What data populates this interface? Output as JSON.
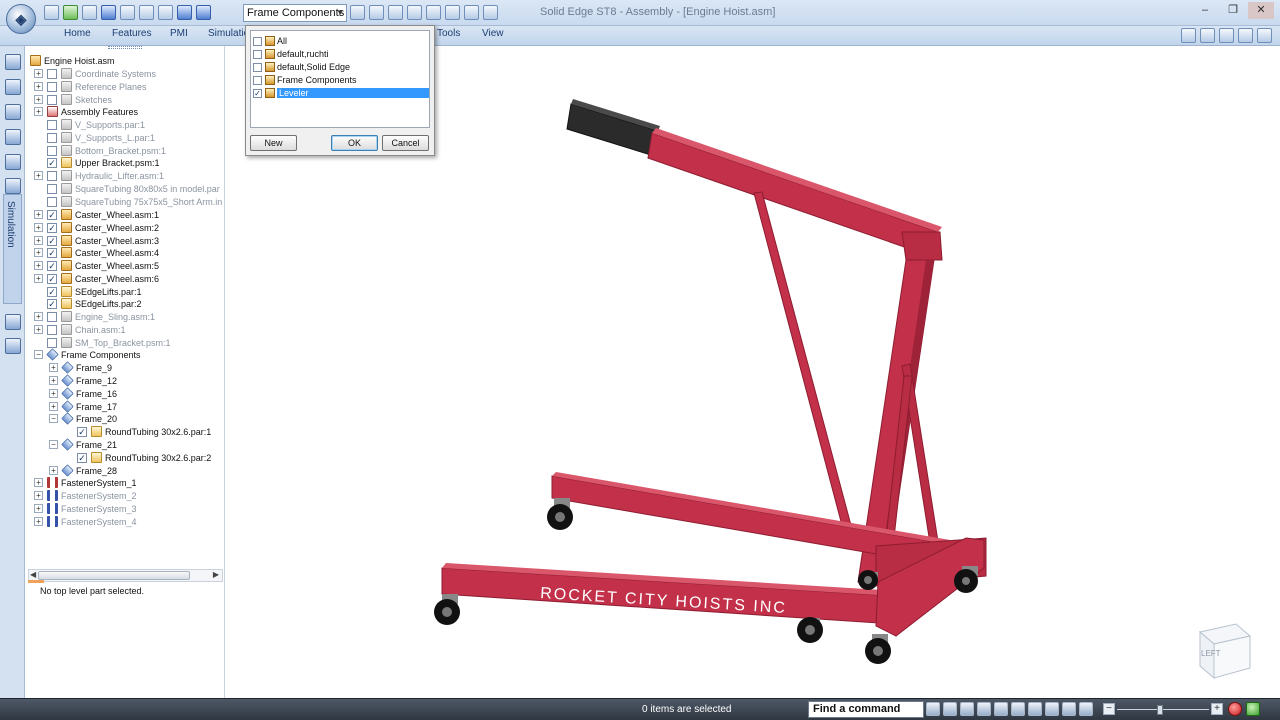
{
  "window": {
    "title": "Solid Edge ST8 - Assembly - [Engine Hoist.asm]"
  },
  "quick_access": {
    "combo_value": "Frame Components"
  },
  "ribbon": {
    "tabs": [
      "Home",
      "Features",
      "PMI",
      "Simulatio",
      "Tools",
      "View"
    ]
  },
  "dock": {
    "simulation_tab": "Simulation"
  },
  "tree": {
    "items": [
      {
        "label": "Engine Hoist.asm"
      },
      {
        "label": "Coordinate Systems"
      },
      {
        "label": "Reference Planes"
      },
      {
        "label": "Sketches"
      },
      {
        "label": "Assembly Features"
      },
      {
        "label": "V_Supports.par:1"
      },
      {
        "label": "V_Supports_L.par:1"
      },
      {
        "label": "Bottom_Bracket.psm:1"
      },
      {
        "label": "Upper Bracket.psm:1"
      },
      {
        "label": "Hydraulic_Lifter.asm:1"
      },
      {
        "label": "SquareTubing 80x80x5 in model.par"
      },
      {
        "label": "SquareTubing 75x75x5_Short Arm.in"
      },
      {
        "label": "Caster_Wheel.asm:1"
      },
      {
        "label": "Caster_Wheel.asm:2"
      },
      {
        "label": "Caster_Wheel.asm:3"
      },
      {
        "label": "Caster_Wheel.asm:4"
      },
      {
        "label": "Caster_Wheel.asm:5"
      },
      {
        "label": "Caster_Wheel.asm:6"
      },
      {
        "label": "SEdgeLifts.par:1"
      },
      {
        "label": "SEdgeLifts.par:2"
      },
      {
        "label": "Engine_Sling.asm:1"
      },
      {
        "label": "Chain.asm:1"
      },
      {
        "label": "SM_Top_Bracket.psm:1"
      },
      {
        "label": "Frame Components"
      },
      {
        "label": "Frame_9"
      },
      {
        "label": "Frame_12"
      },
      {
        "label": "Frame_16"
      },
      {
        "label": "Frame_17"
      },
      {
        "label": "Frame_20"
      },
      {
        "label": "RoundTubing 30x2.6.par:1"
      },
      {
        "label": "Frame_21"
      },
      {
        "label": "RoundTubing 30x2.6.par:2"
      },
      {
        "label": "Frame_28"
      },
      {
        "label": "FastenerSystem_1"
      },
      {
        "label": "FastenerSystem_2"
      },
      {
        "label": "FastenerSystem_3"
      },
      {
        "label": "FastenerSystem_4"
      }
    ]
  },
  "pathfinder_status": "No top level part selected.",
  "dialog": {
    "items": [
      {
        "label": "All",
        "checked": false,
        "selected": false
      },
      {
        "label": "default,ruchti",
        "checked": false,
        "selected": false
      },
      {
        "label": "default,Solid Edge",
        "checked": false,
        "selected": false
      },
      {
        "label": "Frame Components",
        "checked": false,
        "selected": false
      },
      {
        "label": "Leveler",
        "checked": true,
        "selected": true
      }
    ],
    "new_label": "New",
    "ok_label": "OK",
    "cancel_label": "Cancel"
  },
  "model": {
    "decal_text": "ROCKET CITY HOISTS INC"
  },
  "viewcube": {
    "label": "LEFT"
  },
  "statusbar": {
    "selection_text": "0 items are selected",
    "find_command": "Find a command"
  },
  "colors": {
    "frame_red": "#c2304a",
    "frame_dark": "#8e1c30",
    "arm_black": "#2b2b2b",
    "selection_blue": "#3399ff"
  }
}
